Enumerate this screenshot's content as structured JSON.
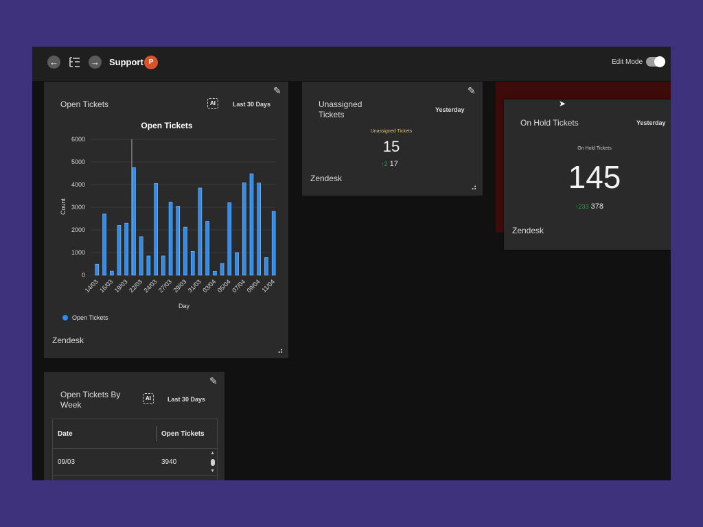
{
  "header": {
    "title": "Support",
    "edit_mode_label": "Edit Mode",
    "back_icon": "arrow-left-icon",
    "tree_icon": "tree-icon",
    "forward_icon": "arrow-right-icon",
    "ppt_glyph": "P"
  },
  "colors": {
    "page_bg": "#3e327c",
    "app_bg": "#111111",
    "card_bg": "#2a2a2a",
    "bar": "#2d8cf0",
    "up": "#22a34a",
    "highlight": "#3d0b0a"
  },
  "open_tickets_card": {
    "title": "Open Tickets",
    "ai_label": "AI",
    "range": "Last 30 Days",
    "source": "Zendesk"
  },
  "chart_data": {
    "type": "bar",
    "title": "Open Tickets",
    "xlabel": "Day",
    "ylabel": "Count",
    "ylim": [
      0,
      6000
    ],
    "yticks": [
      0,
      1000,
      2000,
      3000,
      4000,
      5000,
      6000
    ],
    "legend_placement": "bottom-left",
    "grid": true,
    "x_tick_labels": [
      "14/03",
      "16/03",
      "19/03",
      "22/03",
      "24/03",
      "27/03",
      "29/03",
      "31/03",
      "03/04",
      "05/04",
      "07/04",
      "09/04",
      "11/04"
    ],
    "series": [
      {
        "name": "Open Tickets",
        "color": "#2d8cf0",
        "values": [
          480,
          2700,
          180,
          2200,
          2300,
          4750,
          1700,
          850,
          4050,
          850,
          3230,
          3050,
          2120,
          1050,
          3850,
          2380,
          170,
          520,
          3200,
          1000,
          4080,
          4480,
          4070,
          780,
          2820
        ]
      }
    ]
  },
  "unassigned_card": {
    "title": "Unassigned Tickets",
    "range": "Yesterday",
    "caption": "Unassigned Tickets",
    "value": "15",
    "change_arrow": "↑",
    "change_delta": "2",
    "previous": "17",
    "source": "Zendesk"
  },
  "onhold_card": {
    "title": "On Hold Tickets",
    "range": "Yesterday",
    "caption": "On Hold Tickets",
    "value": "145",
    "change_arrow": "↑",
    "change_delta": "233",
    "previous": "378",
    "source": "Zendesk"
  },
  "weekly_card": {
    "title": "Open Tickets By Week",
    "ai_label": "AI",
    "range": "Last 30 Days",
    "columns": [
      "Date",
      "Open Tickets"
    ],
    "rows": [
      [
        "09/03",
        "3940"
      ]
    ]
  }
}
